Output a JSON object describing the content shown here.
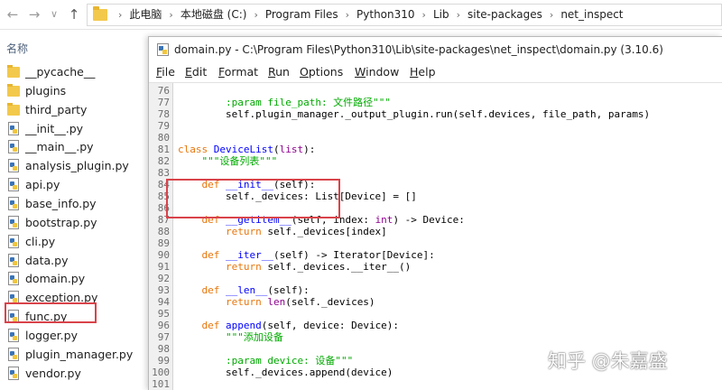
{
  "explorer": {
    "back_glyph": "←",
    "forward_glyph": "→",
    "recent_glyph": "∨",
    "up_glyph": "↑",
    "breadcrumbs": [
      "此电脑",
      "本地磁盘 (C:)",
      "Program Files",
      "Python310",
      "Lib",
      "site-packages",
      "net_inspect"
    ],
    "breadcrumb_sep": "›",
    "column_header": "名称",
    "files": [
      {
        "name": "__pycache__",
        "type": "folder"
      },
      {
        "name": "plugins",
        "type": "folder"
      },
      {
        "name": "third_party",
        "type": "folder"
      },
      {
        "name": "__init__.py",
        "type": "py"
      },
      {
        "name": "__main__.py",
        "type": "py"
      },
      {
        "name": "analysis_plugin.py",
        "type": "py"
      },
      {
        "name": "api.py",
        "type": "py"
      },
      {
        "name": "base_info.py",
        "type": "py"
      },
      {
        "name": "bootstrap.py",
        "type": "py"
      },
      {
        "name": "cli.py",
        "type": "py"
      },
      {
        "name": "data.py",
        "type": "py"
      },
      {
        "name": "domain.py",
        "type": "py"
      },
      {
        "name": "exception.py",
        "type": "py"
      },
      {
        "name": "func.py",
        "type": "py"
      },
      {
        "name": "logger.py",
        "type": "py"
      },
      {
        "name": "plugin_manager.py",
        "type": "py"
      },
      {
        "name": "vendor.py",
        "type": "py"
      }
    ],
    "highlighted_file": "domain.py"
  },
  "editor": {
    "title": "domain.py - C:\\Program Files\\Python310\\Lib\\site-packages\\net_inspect\\domain.py (3.10.6)",
    "menu": [
      {
        "ul": "F",
        "rest": "ile"
      },
      {
        "ul": "E",
        "rest": "dit"
      },
      {
        "ul": "F",
        "rest": "ormat"
      },
      {
        "ul": "R",
        "rest": "un"
      },
      {
        "ul": "O",
        "rest": "ptions"
      },
      {
        "ul": "W",
        "rest": "indow"
      },
      {
        "ul": "H",
        "rest": "elp"
      }
    ],
    "lines": [
      {
        "n": "76",
        "t": []
      },
      {
        "n": "77",
        "t": [
          [
            "st",
            "        :param file_path: 文件路径\"\"\""
          ]
        ]
      },
      {
        "n": "78",
        "t": [
          [
            "",
            "        self.plugin_manager._output_plugin.run(self.devices, file_path, params)"
          ]
        ]
      },
      {
        "n": "79",
        "t": []
      },
      {
        "n": "80",
        "t": []
      },
      {
        "n": "81",
        "t": [
          [
            "kw",
            "class "
          ],
          [
            "df",
            "DeviceList"
          ],
          [
            "",
            "("
          ],
          [
            "bi",
            "list"
          ],
          [
            "",
            "):"
          ]
        ]
      },
      {
        "n": "82",
        "t": [
          [
            "st",
            "    \"\"\"设备列表\"\"\""
          ]
        ]
      },
      {
        "n": "83",
        "t": []
      },
      {
        "n": "84",
        "t": [
          [
            "kw",
            "    def "
          ],
          [
            "df",
            "__init__"
          ],
          [
            "",
            "(self):"
          ]
        ]
      },
      {
        "n": "85",
        "t": [
          [
            "",
            "        self._devices: List[Device] = []"
          ]
        ]
      },
      {
        "n": "86",
        "t": []
      },
      {
        "n": "87",
        "t": [
          [
            "kw",
            "    def "
          ],
          [
            "df",
            "__getitem__"
          ],
          [
            "",
            "(self, index: "
          ],
          [
            "bi",
            "int"
          ],
          [
            "",
            ") -> Device:"
          ]
        ]
      },
      {
        "n": "88",
        "t": [
          [
            "kw",
            "        return "
          ],
          [
            "",
            "self._devices[index]"
          ]
        ]
      },
      {
        "n": "89",
        "t": []
      },
      {
        "n": "90",
        "t": [
          [
            "kw",
            "    def "
          ],
          [
            "df",
            "__iter__"
          ],
          [
            "",
            "(self) -> Iterator[Device]:"
          ]
        ]
      },
      {
        "n": "91",
        "t": [
          [
            "kw",
            "        return "
          ],
          [
            "",
            "self._devices.__iter__()"
          ]
        ]
      },
      {
        "n": "92",
        "t": []
      },
      {
        "n": "93",
        "t": [
          [
            "kw",
            "    def "
          ],
          [
            "df",
            "__len__"
          ],
          [
            "",
            "(self):"
          ]
        ]
      },
      {
        "n": "94",
        "t": [
          [
            "kw",
            "        return "
          ],
          [
            "bi",
            "len"
          ],
          [
            "",
            "(self._devices)"
          ]
        ]
      },
      {
        "n": "95",
        "t": []
      },
      {
        "n": "96",
        "t": [
          [
            "kw",
            "    def "
          ],
          [
            "df",
            "append"
          ],
          [
            "",
            "(self, device: Device):"
          ]
        ]
      },
      {
        "n": "97",
        "t": [
          [
            "st",
            "        \"\"\"添加设备"
          ]
        ]
      },
      {
        "n": "98",
        "t": []
      },
      {
        "n": "99",
        "t": [
          [
            "st",
            "        :param device: 设备\"\"\""
          ]
        ]
      },
      {
        "n": "100",
        "t": [
          [
            "",
            "        self._devices.append(device)"
          ]
        ]
      },
      {
        "n": "101",
        "t": []
      }
    ]
  },
  "watermark": "知乎 @朱嘉盛",
  "colors": {
    "keyword": "#e8760b",
    "builtin": "#900090",
    "definition": "#0000ff",
    "string": "#00aa00",
    "highlight_box": "#d9434a"
  }
}
